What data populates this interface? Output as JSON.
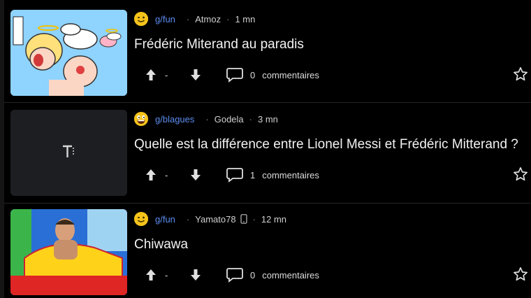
{
  "posts": [
    {
      "group": "g/fun",
      "author": "Atmoz",
      "age": "1 mn",
      "title": "Frédéric Miterand au paradis",
      "score": "-",
      "comment_count": "0",
      "comment_label": "commentaires",
      "emoji": "winking-face",
      "thumbnail": "cartoon-image"
    },
    {
      "group": "g/blagues",
      "author": "Godela",
      "age": "3 mn",
      "title": "Quelle est la différence entre Lionel Messi et Frédéric Mitterand ?",
      "score": "-",
      "comment_count": "1",
      "comment_label": "commentaires",
      "emoji": "grinning-face",
      "thumbnail": "text-post-placeholder"
    },
    {
      "group": "g/fun",
      "author": "Yamato78",
      "age": "12 mn",
      "title": "Chiwawa",
      "score": "-",
      "comment_count": "0",
      "comment_label": "commentaires",
      "emoji": "winking-face",
      "thumbnail": "toy-box-image",
      "author_device": "mobile-icon"
    }
  ],
  "colors": {
    "background": "#000000",
    "group_link": "#5b8def",
    "text": "#f2f2f2",
    "emoji": "#f6c31b"
  }
}
